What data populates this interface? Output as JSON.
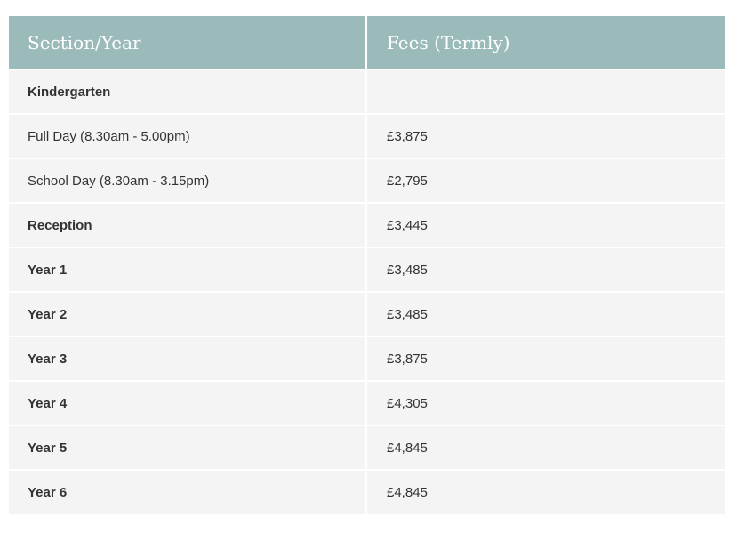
{
  "table": {
    "headers": {
      "section": "Section/Year",
      "fees": "Fees (Termly)"
    },
    "rows": [
      {
        "section": "Kindergarten",
        "fee": "",
        "bold": true
      },
      {
        "section": "Full Day (8.30am - 5.00pm)",
        "fee": "£3,875",
        "bold": false
      },
      {
        "section": "School Day (8.30am - 3.15pm)",
        "fee": "£2,795",
        "bold": false
      },
      {
        "section": "Reception",
        "fee": "£3,445",
        "bold": true
      },
      {
        "section": "Year 1",
        "fee": "£3,485",
        "bold": true
      },
      {
        "section": "Year 2",
        "fee": "£3,485",
        "bold": true
      },
      {
        "section": "Year 3",
        "fee": "£3,875",
        "bold": true
      },
      {
        "section": "Year 4",
        "fee": "£4,305",
        "bold": true
      },
      {
        "section": "Year 5",
        "fee": "£4,845",
        "bold": true
      },
      {
        "section": "Year 6",
        "fee": "£4,845",
        "bold": true
      }
    ]
  },
  "colors": {
    "header_bg": "#9bbbba",
    "row_bg": "#f4f4f4",
    "text": "#333333"
  }
}
